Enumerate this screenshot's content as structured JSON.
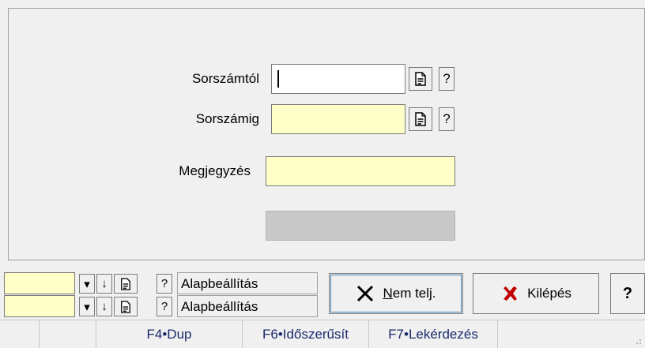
{
  "form": {
    "sorszamtol": {
      "label": "Sorszámtól",
      "value": ""
    },
    "sorszamig": {
      "label": "Sorszámig",
      "value": ""
    },
    "megjegyzes": {
      "label": "Megjegyzés",
      "value": ""
    },
    "question_glyph": "?"
  },
  "toolrows": [
    {
      "value": "",
      "label": "Alapbeállítás",
      "down_glyph": "▾",
      "arrow_glyph": "↓",
      "help_glyph": "?"
    },
    {
      "value": "",
      "label": "Alapbeállítás",
      "down_glyph": "▾",
      "arrow_glyph": "↓",
      "help_glyph": "?"
    }
  ],
  "buttons": {
    "nem_telj_pre": "",
    "nem_telj_mnemonic": "N",
    "nem_telj_rest": "em telj.",
    "kilepes": "Kilépés",
    "help": "?"
  },
  "statusbar": {
    "f4": "F4•Dup",
    "f6": "F6•Időszerűsít",
    "f7": "F7•Lekérdezés"
  },
  "colors": {
    "field_bg": "#ffffc8",
    "kilepes_x": "#c00000"
  }
}
